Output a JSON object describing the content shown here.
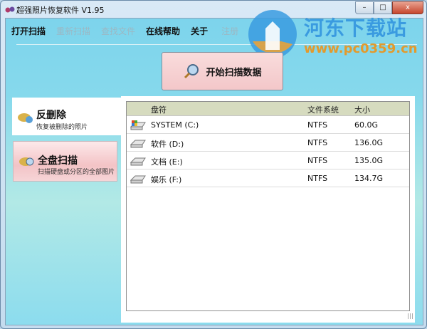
{
  "window": {
    "title": "超强照片恢复软件 V1.95",
    "controls": {
      "minimize": "–",
      "maximize": "□",
      "close": "x"
    }
  },
  "menu": [
    {
      "label": "打开扫描",
      "enabled": true
    },
    {
      "label": "重新扫描",
      "enabled": false
    },
    {
      "label": "查找文件",
      "enabled": false
    },
    {
      "label": "在线帮助",
      "enabled": true
    },
    {
      "label": "关于",
      "enabled": true
    },
    {
      "label": "注册",
      "enabled": false
    }
  ],
  "scan_button": {
    "label": "开始扫描数据",
    "icon": "magnifier-icon"
  },
  "watermark": {
    "name": "河东下载站",
    "url": "www.pc0359.cn"
  },
  "modes": [
    {
      "title": "反删除",
      "subtitle": "恢复被删除的照片"
    },
    {
      "title": "全盘扫描",
      "subtitle": "扫描硬盘或分区的全部图片"
    }
  ],
  "table": {
    "headers": [
      "盘符",
      "文件系统",
      "大小"
    ],
    "rows": [
      {
        "name": "SYSTEM (C:)",
        "fs": "NTFS",
        "size": "60.0G",
        "icon": "system-drive-icon"
      },
      {
        "name": "软件 (D:)",
        "fs": "NTFS",
        "size": "136.0G",
        "icon": "drive-icon"
      },
      {
        "name": "文档 (E:)",
        "fs": "NTFS",
        "size": "135.0G",
        "icon": "drive-icon"
      },
      {
        "name": "娱乐 (F:)",
        "fs": "NTFS",
        "size": "134.7G",
        "icon": "drive-icon"
      }
    ]
  }
}
